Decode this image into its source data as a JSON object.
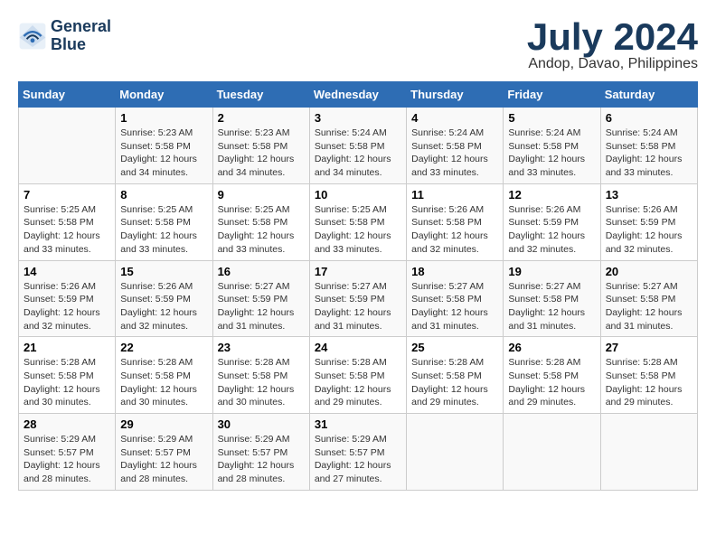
{
  "logo": {
    "line1": "General",
    "line2": "Blue"
  },
  "title": "July 2024",
  "location": "Andop, Davao, Philippines",
  "days_header": [
    "Sunday",
    "Monday",
    "Tuesday",
    "Wednesday",
    "Thursday",
    "Friday",
    "Saturday"
  ],
  "weeks": [
    [
      {
        "day": "",
        "info": ""
      },
      {
        "day": "1",
        "info": "Sunrise: 5:23 AM\nSunset: 5:58 PM\nDaylight: 12 hours\nand 34 minutes."
      },
      {
        "day": "2",
        "info": "Sunrise: 5:23 AM\nSunset: 5:58 PM\nDaylight: 12 hours\nand 34 minutes."
      },
      {
        "day": "3",
        "info": "Sunrise: 5:24 AM\nSunset: 5:58 PM\nDaylight: 12 hours\nand 34 minutes."
      },
      {
        "day": "4",
        "info": "Sunrise: 5:24 AM\nSunset: 5:58 PM\nDaylight: 12 hours\nand 33 minutes."
      },
      {
        "day": "5",
        "info": "Sunrise: 5:24 AM\nSunset: 5:58 PM\nDaylight: 12 hours\nand 33 minutes."
      },
      {
        "day": "6",
        "info": "Sunrise: 5:24 AM\nSunset: 5:58 PM\nDaylight: 12 hours\nand 33 minutes."
      }
    ],
    [
      {
        "day": "7",
        "info": "Sunrise: 5:25 AM\nSunset: 5:58 PM\nDaylight: 12 hours\nand 33 minutes."
      },
      {
        "day": "8",
        "info": "Sunrise: 5:25 AM\nSunset: 5:58 PM\nDaylight: 12 hours\nand 33 minutes."
      },
      {
        "day": "9",
        "info": "Sunrise: 5:25 AM\nSunset: 5:58 PM\nDaylight: 12 hours\nand 33 minutes."
      },
      {
        "day": "10",
        "info": "Sunrise: 5:25 AM\nSunset: 5:58 PM\nDaylight: 12 hours\nand 33 minutes."
      },
      {
        "day": "11",
        "info": "Sunrise: 5:26 AM\nSunset: 5:58 PM\nDaylight: 12 hours\nand 32 minutes."
      },
      {
        "day": "12",
        "info": "Sunrise: 5:26 AM\nSunset: 5:59 PM\nDaylight: 12 hours\nand 32 minutes."
      },
      {
        "day": "13",
        "info": "Sunrise: 5:26 AM\nSunset: 5:59 PM\nDaylight: 12 hours\nand 32 minutes."
      }
    ],
    [
      {
        "day": "14",
        "info": "Sunrise: 5:26 AM\nSunset: 5:59 PM\nDaylight: 12 hours\nand 32 minutes."
      },
      {
        "day": "15",
        "info": "Sunrise: 5:26 AM\nSunset: 5:59 PM\nDaylight: 12 hours\nand 32 minutes."
      },
      {
        "day": "16",
        "info": "Sunrise: 5:27 AM\nSunset: 5:59 PM\nDaylight: 12 hours\nand 31 minutes."
      },
      {
        "day": "17",
        "info": "Sunrise: 5:27 AM\nSunset: 5:59 PM\nDaylight: 12 hours\nand 31 minutes."
      },
      {
        "day": "18",
        "info": "Sunrise: 5:27 AM\nSunset: 5:58 PM\nDaylight: 12 hours\nand 31 minutes."
      },
      {
        "day": "19",
        "info": "Sunrise: 5:27 AM\nSunset: 5:58 PM\nDaylight: 12 hours\nand 31 minutes."
      },
      {
        "day": "20",
        "info": "Sunrise: 5:27 AM\nSunset: 5:58 PM\nDaylight: 12 hours\nand 31 minutes."
      }
    ],
    [
      {
        "day": "21",
        "info": "Sunrise: 5:28 AM\nSunset: 5:58 PM\nDaylight: 12 hours\nand 30 minutes."
      },
      {
        "day": "22",
        "info": "Sunrise: 5:28 AM\nSunset: 5:58 PM\nDaylight: 12 hours\nand 30 minutes."
      },
      {
        "day": "23",
        "info": "Sunrise: 5:28 AM\nSunset: 5:58 PM\nDaylight: 12 hours\nand 30 minutes."
      },
      {
        "day": "24",
        "info": "Sunrise: 5:28 AM\nSunset: 5:58 PM\nDaylight: 12 hours\nand 29 minutes."
      },
      {
        "day": "25",
        "info": "Sunrise: 5:28 AM\nSunset: 5:58 PM\nDaylight: 12 hours\nand 29 minutes."
      },
      {
        "day": "26",
        "info": "Sunrise: 5:28 AM\nSunset: 5:58 PM\nDaylight: 12 hours\nand 29 minutes."
      },
      {
        "day": "27",
        "info": "Sunrise: 5:28 AM\nSunset: 5:58 PM\nDaylight: 12 hours\nand 29 minutes."
      }
    ],
    [
      {
        "day": "28",
        "info": "Sunrise: 5:29 AM\nSunset: 5:57 PM\nDaylight: 12 hours\nand 28 minutes."
      },
      {
        "day": "29",
        "info": "Sunrise: 5:29 AM\nSunset: 5:57 PM\nDaylight: 12 hours\nand 28 minutes."
      },
      {
        "day": "30",
        "info": "Sunrise: 5:29 AM\nSunset: 5:57 PM\nDaylight: 12 hours\nand 28 minutes."
      },
      {
        "day": "31",
        "info": "Sunrise: 5:29 AM\nSunset: 5:57 PM\nDaylight: 12 hours\nand 27 minutes."
      },
      {
        "day": "",
        "info": ""
      },
      {
        "day": "",
        "info": ""
      },
      {
        "day": "",
        "info": ""
      }
    ]
  ]
}
